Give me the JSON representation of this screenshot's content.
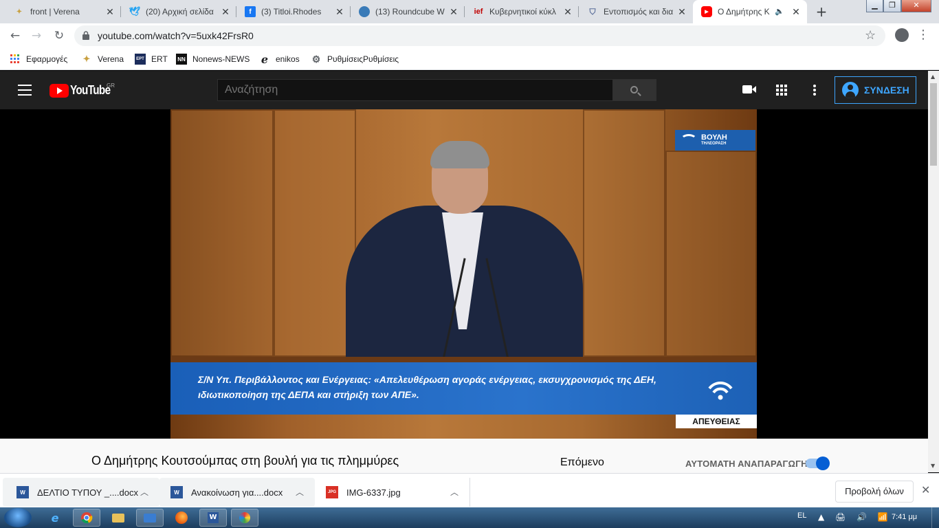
{
  "browser": {
    "tabs": [
      {
        "title": "front | Verena",
        "favicon": "verena-icon",
        "color": "#c8a040"
      },
      {
        "title": "(20) Αρχική σελίδα",
        "favicon": "twitter-icon",
        "color": "#1da1f2"
      },
      {
        "title": "(3) Titloi.Rhodes",
        "favicon": "facebook-icon",
        "color": "#1877f2"
      },
      {
        "title": "(13) Roundcube W",
        "favicon": "roundcube-icon",
        "color": "#3a7bb8"
      },
      {
        "title": "Κυβερνητικοί κύκλ",
        "favicon": "ief-icon",
        "color": "#c00000"
      },
      {
        "title": "Εντοπισμός και δια",
        "favicon": "shield-icon",
        "color": "#5a6e9a"
      },
      {
        "title": "Ο Δημήτρης Κ",
        "favicon": "youtube-icon",
        "color": "#ff0000",
        "active": true,
        "audio": true
      }
    ],
    "url": "youtube.com/watch?v=5uxk42FrsR0",
    "bookmarks": [
      {
        "label": "Εφαρμογές",
        "icon": "apps-grid-icon"
      },
      {
        "label": "Verena",
        "icon": "verena-icon"
      },
      {
        "label": "ERT",
        "icon": "ert-icon"
      },
      {
        "label": "Nonews-NEWS",
        "icon": "nn-icon"
      },
      {
        "label": "enikos",
        "icon": "enikos-icon"
      },
      {
        "label": "ΡυθμίσειςΡυθμίσεις",
        "icon": "settings-icon"
      }
    ]
  },
  "youtube": {
    "logo_text": "YouTube",
    "country": "GR",
    "search_placeholder": "Αναζήτηση",
    "signin_label": "ΣΥΝΔΕΣΗ",
    "accent": "#3ea6ff"
  },
  "video": {
    "channel_logo_line1": "ΒΟΥΛΗ",
    "channel_logo_line2": "ΤΗΛΕΟΡΑΣΗ",
    "caption_line1": "Σ/Ν Υπ. Περιβάλλοντος και Ενέργειας:  «Απελευθέρωση αγοράς ενέργειας, εκσυγχρονισμός της ΔΕΗ,",
    "caption_line2": "ιδιωτικοποίηση της ΔΕΠΑ και στήριξη των ΑΠΕ».",
    "live_badge": "ΑΠΕΥΘΕΙΑΣ"
  },
  "page": {
    "video_title": "Ο Δημήτρης Κουτσούμπας στη βουλή για τις πλημμύρες",
    "next_label": "Επόμενο",
    "autoplay_label": "ΑΥΤΟΜΑΤΗ ΑΝΑΠΑΡΑΓΩΓΗ",
    "autoplay_on": true
  },
  "downloads": {
    "items": [
      {
        "name": "ΔΕΛΤΙΟ ΤΥΠΟΥ _....docx",
        "icon": "word-doc-icon"
      },
      {
        "name": "Ανακοίνωση για....docx",
        "icon": "word-doc-icon"
      },
      {
        "name": "IMG-6337.jpg",
        "icon": "jpg-icon"
      }
    ],
    "show_all": "Προβολή όλων"
  },
  "taskbar": {
    "language": "EL",
    "time": "7:41 μμ",
    "apps": [
      "ie-icon",
      "chrome-icon",
      "explorer-icon",
      "outlook-icon",
      "firefox-icon",
      "word-icon",
      "paint-icon"
    ]
  }
}
